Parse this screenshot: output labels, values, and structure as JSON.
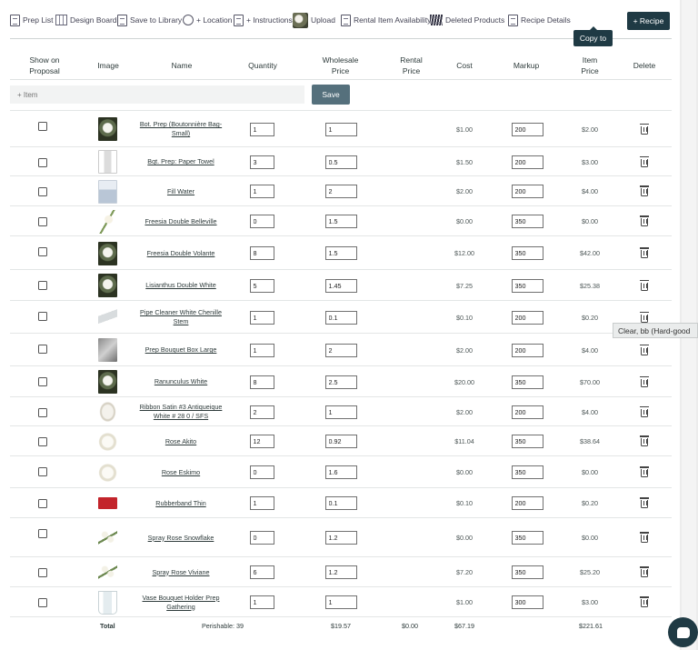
{
  "toolbar": {
    "items": [
      {
        "label": "Prep List",
        "icon": "document-icon"
      },
      {
        "label": "Design Board",
        "icon": "grid-icon"
      },
      {
        "label": "Save to Library",
        "icon": "file-icon"
      },
      {
        "label": "+ Location",
        "icon": "location-pin-icon"
      },
      {
        "label": "+ Instructions",
        "icon": "instructions-icon"
      },
      {
        "label": "Upload",
        "icon": "upload-thumbnail-icon"
      },
      {
        "label": "Rental Item Availability",
        "icon": "calendar-doc-icon"
      },
      {
        "label": "Deleted Products",
        "icon": "books-icon"
      },
      {
        "label": "Recipe Details",
        "icon": "recipe-details-icon"
      }
    ],
    "recipe_button": "+ Recipe",
    "copy_tooltip": "Copy to"
  },
  "headers": {
    "show_on_proposal": "Show on Proposal",
    "image": "Image",
    "name": "Name",
    "quantity": "Quantity",
    "wholesale_price": "Wholesale Price",
    "rental_price": "Rental Price",
    "cost": "Cost",
    "markup": "Markup",
    "item_price": "Item Price",
    "delete": "Delete"
  },
  "add_item": {
    "placeholder": "+ Item",
    "save_label": "Save"
  },
  "rows": [
    {
      "name": "Bot. Prep (Boutonnière Bag-Small)",
      "qty": "1",
      "wholesale": "1",
      "cost": "$1.00",
      "markup": "200",
      "item_price": "$2.00",
      "thumb": "white-flower-dark"
    },
    {
      "name": "Bqt. Prep: Paper Towel",
      "qty": "3",
      "wholesale": "0.5",
      "cost": "$1.50",
      "markup": "200",
      "item_price": "$3.00",
      "thumb": "paper-towel"
    },
    {
      "name": "Fill Water",
      "qty": "1",
      "wholesale": "2",
      "cost": "$2.00",
      "markup": "200",
      "item_price": "$4.00",
      "thumb": "water-jug"
    },
    {
      "name": "Freesia Double Belleville",
      "qty": "0",
      "wholesale": "1.5",
      "cost": "$0.00",
      "markup": "350",
      "item_price": "$0.00",
      "thumb": "freesia-stem"
    },
    {
      "name": "Freesia Double Volante",
      "qty": "8",
      "wholesale": "1.5",
      "cost": "$12.00",
      "markup": "350",
      "item_price": "$42.00",
      "thumb": "white-flower-dark"
    },
    {
      "name": "Lisianthus Double White",
      "qty": "5",
      "wholesale": "1.45",
      "cost": "$7.25",
      "markup": "350",
      "item_price": "$25.38",
      "thumb": "white-flower-dark"
    },
    {
      "name": "Pipe Cleaner White Chenille Stem",
      "qty": "1",
      "wholesale": "0.1",
      "cost": "$0.10",
      "markup": "200",
      "item_price": "$0.20",
      "thumb": "pipe-cleaner"
    },
    {
      "name": "Prep Bouquet Box Large",
      "qty": "1",
      "wholesale": "2",
      "cost": "$2.00",
      "markup": "200",
      "item_price": "$4.00",
      "thumb": "box-grey"
    },
    {
      "name": "Ranunculus White",
      "qty": "8",
      "wholesale": "2.5",
      "cost": "$20.00",
      "markup": "350",
      "item_price": "$70.00",
      "thumb": "white-flower-dark"
    },
    {
      "name": "Ribbon Satin #3 Antiqueique White # 28 0 / SFS",
      "qty": "2",
      "wholesale": "1",
      "cost": "$2.00",
      "markup": "200",
      "item_price": "$4.00",
      "thumb": "ribbon"
    },
    {
      "name": "Rose Akito",
      "qty": "12",
      "wholesale": "0.92",
      "cost": "$11.04",
      "markup": "350",
      "item_price": "$38.64",
      "thumb": "white-rose"
    },
    {
      "name": "Rose Eskimo",
      "qty": "0",
      "wholesale": "1.6",
      "cost": "$0.00",
      "markup": "350",
      "item_price": "$0.00",
      "thumb": "white-rose"
    },
    {
      "name": "Rubberband Thin",
      "qty": "1",
      "wholesale": "0.1",
      "cost": "$0.10",
      "markup": "200",
      "item_price": "$0.20",
      "thumb": "red-pack"
    },
    {
      "name": "Spray Rose Snowflake",
      "qty": "0",
      "wholesale": "1.2",
      "cost": "$0.00",
      "markup": "350",
      "item_price": "$0.00",
      "thumb": "spray-rose"
    },
    {
      "name": "Spray Rose Viviane",
      "qty": "6",
      "wholesale": "1.2",
      "cost": "$7.20",
      "markup": "350",
      "item_price": "$25.20",
      "thumb": "spray-rose"
    },
    {
      "name": "Vase Bouquet Holder Prep Gathering",
      "qty": "1",
      "wholesale": "1",
      "cost": "$1.00",
      "markup": "300",
      "item_price": "$3.00",
      "thumb": "glass-vase"
    }
  ],
  "hover_tooltip": "Clear, bb (Hard-good",
  "totals": {
    "label": "Total",
    "perishable": "Perishable: 39",
    "wholesale": "$19.57",
    "rental": "$0.00",
    "cost": "$67.19",
    "item_price": "$221.61"
  }
}
